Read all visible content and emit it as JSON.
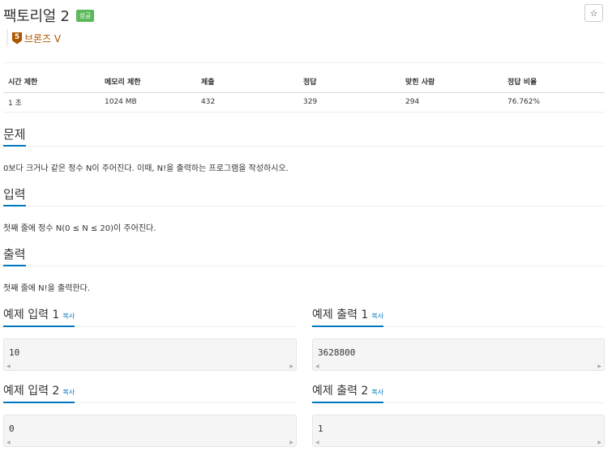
{
  "problem": {
    "title": "팩토리얼 2",
    "status_badge": "성공",
    "tier_number": "5",
    "tier_label": "브론즈 V"
  },
  "toolbar": {
    "star_icon": "☆"
  },
  "stats": {
    "headers": [
      "시간 제한",
      "메모리 제한",
      "제출",
      "정답",
      "맞힌 사람",
      "정답 비율"
    ],
    "values": [
      "1 초",
      "1024 MB",
      "432",
      "329",
      "294",
      "76.762%"
    ]
  },
  "sections": {
    "problem": {
      "heading": "문제",
      "text": "0보다 크거나 같은 정수 N이 주어진다. 이때, N!을 출력하는 프로그램을 작성하시오."
    },
    "input": {
      "heading": "입력",
      "text": "첫째 줄에 정수 N(0 ≤ N ≤ 20)이 주어진다."
    },
    "output": {
      "heading": "출력",
      "text": "첫째 줄에 N!을 출력한다."
    }
  },
  "samples": [
    {
      "input_heading": "예제 입력 1",
      "output_heading": "예제 출력 1",
      "copy_label": "복사",
      "input": "10",
      "output": "3628800"
    },
    {
      "input_heading": "예제 입력 2",
      "output_heading": "예제 출력 2",
      "copy_label": "복사",
      "input": "0",
      "output": "1"
    }
  ]
}
